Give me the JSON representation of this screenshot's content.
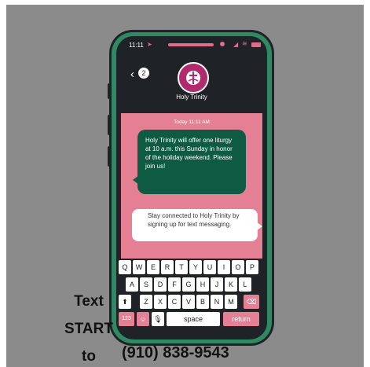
{
  "status_bar": {
    "time": "11:11"
  },
  "conversation": {
    "back_count": "2",
    "contact_name": "Holy Trinity",
    "timestamp": "Today 11:11 AM",
    "messages": [
      {
        "from": "contact",
        "text": "Holy Trinity will offer one liturgy at 10 a.m. this Sunday in honor of the holiday weekend. Please join us!"
      },
      {
        "from": "me",
        "text": "Stay connected to Holy Trinity by signing up for text messaging."
      }
    ]
  },
  "keyboard": {
    "row1": [
      "Q",
      "W",
      "E",
      "R",
      "T",
      "Y",
      "U",
      "I",
      "O",
      "P"
    ],
    "row2": [
      "A",
      "S",
      "D",
      "F",
      "G",
      "H",
      "J",
      "K",
      "L"
    ],
    "row3": [
      "Z",
      "X",
      "C",
      "V",
      "B",
      "N",
      "M"
    ],
    "row4": {
      "numbers": "123",
      "space": "space",
      "return": "return"
    }
  },
  "promo": {
    "line1": "Text",
    "line2": "START",
    "line3": "to",
    "phone_number": "(910) 838-9543"
  },
  "colors": {
    "background": "#8b8b8b",
    "phone_body": "#2f8a64",
    "screen_dark": "#1f2328",
    "accent_pink": "#e57f93",
    "message_green": "#0f5a42"
  },
  "icons": [
    "back-icon",
    "signal-icon",
    "wifi-icon",
    "battery-icon",
    "shift-icon",
    "delete-icon",
    "emoji-icon",
    "mic-icon",
    "church-logo-icon"
  ]
}
